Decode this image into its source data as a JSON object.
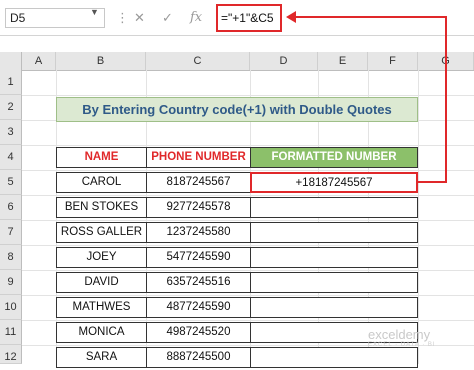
{
  "formula_bar": {
    "name_box": "D5",
    "cancel_icon": "✕",
    "enter_icon": "✓",
    "fx_label": "fx",
    "formula": "=\"+1\"&C5"
  },
  "columns": [
    "A",
    "B",
    "C",
    "D",
    "E",
    "F",
    "G"
  ],
  "rows": [
    "1",
    "2",
    "3",
    "4",
    "5",
    "6",
    "7",
    "8",
    "9",
    "10",
    "11",
    "12"
  ],
  "title": "By Entering Country code(+1) with Double Quotes",
  "table": {
    "headers": [
      "NAME",
      "PHONE NUMBER",
      "FORMATTED NUMBER"
    ],
    "rows": [
      [
        "CAROL",
        "8187245567",
        "+18187245567"
      ],
      [
        "BEN STOKES",
        "9277245578",
        ""
      ],
      [
        "ROSS GALLER",
        "1237245580",
        ""
      ],
      [
        "JOEY",
        "5477245590",
        ""
      ],
      [
        "DAVID",
        "6357245516",
        ""
      ],
      [
        "MATHWES",
        "4877245590",
        ""
      ],
      [
        "MONICA",
        "4987245520",
        ""
      ],
      [
        "SARA",
        "8887245500",
        ""
      ]
    ]
  },
  "accent_color": "#e0282a",
  "header_green": "#8cc06a",
  "watermark": {
    "brand": "exceldemy",
    "tagline": "EXCEL · DATA · BI"
  }
}
